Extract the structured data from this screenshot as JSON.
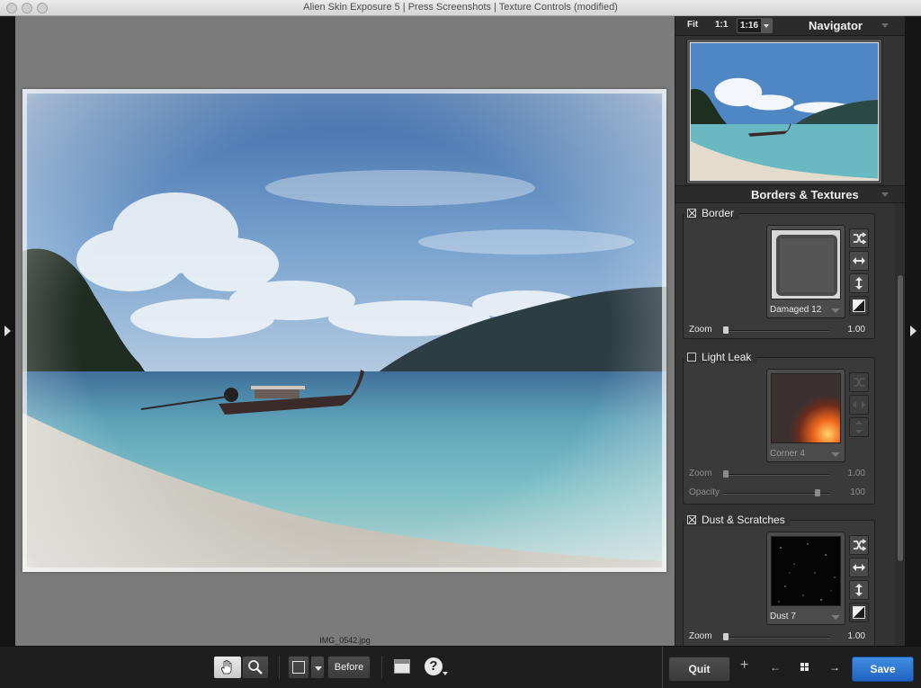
{
  "window": {
    "title": "Alien Skin Exposure 5 | Press Screenshots | Texture Controls (modified)"
  },
  "canvas": {
    "filename": "IMG_0542.jpg"
  },
  "navigator": {
    "title": "Navigator",
    "zoom_fit": "Fit",
    "zoom_1_1": "1:1",
    "zoom_select_value": "1:16"
  },
  "borders_textures": {
    "title": "Borders & Textures",
    "border": {
      "label": "Border",
      "enabled": true,
      "texture": "Damaged 12",
      "zoom_label": "Zoom",
      "zoom_value": "1.00"
    },
    "light_leak": {
      "label": "Light Leak",
      "enabled": false,
      "texture": "Corner 4",
      "zoom_label": "Zoom",
      "zoom_value": "1.00",
      "opacity_label": "Opacity",
      "opacity_value": "100"
    },
    "dust_scratches": {
      "label": "Dust & Scratches",
      "enabled": true,
      "texture": "Dust 7",
      "zoom_label": "Zoom",
      "zoom_value": "1.00"
    }
  },
  "toolbar": {
    "before_label": "Before",
    "help_label": "?",
    "quit_label": "Quit",
    "save_label": "Save"
  },
  "colors": {
    "accent": "#2f78d6",
    "panel": "#333333",
    "canvas": "#7b7b7b"
  },
  "icons": {
    "pan_tool": "hand-icon",
    "zoom_tool": "magnifier-icon",
    "crop": "crop-icon",
    "split_view": "split-view-icon",
    "help": "help-icon",
    "add": "plus-icon",
    "prev": "arrow-left-icon",
    "grid": "grid-icon",
    "next": "arrow-right-icon"
  }
}
